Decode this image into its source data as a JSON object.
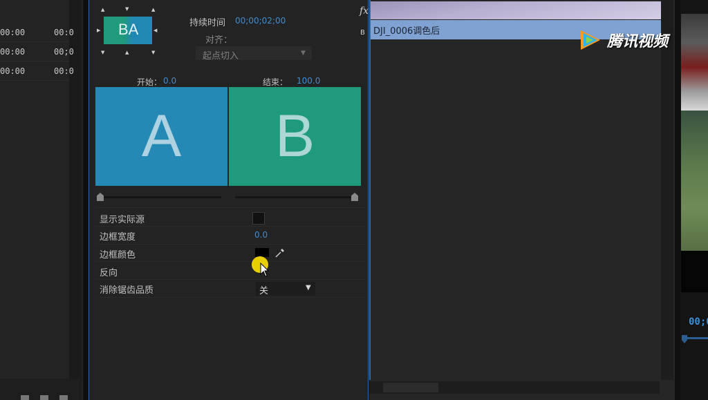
{
  "left_panel": {
    "rows": [
      {
        "c1": "00:00",
        "c2": "00:0"
      },
      {
        "c1": "00:00",
        "c2": "00;0"
      },
      {
        "c1": "00:00",
        "c2": "00:0"
      }
    ]
  },
  "effect_controls": {
    "thumb_letters": "BA",
    "duration_label": "持续时间",
    "duration_value": "00;00;02;00",
    "align_label": "对齐：",
    "align_value": "起点切入",
    "start_label": "开始：",
    "start_value": "0.0",
    "end_label": "结束：",
    "end_value": "100.0",
    "preview_a": "A",
    "preview_b": "B",
    "props": {
      "show_actual_sources": "显示实际源",
      "border_width": "边框宽度",
      "border_width_value": "0.0",
      "border_color": "边框颜色",
      "reverse": "反向",
      "antialias_quality": "消除锯齿品质",
      "antialias_value": "关"
    },
    "fx_badge": "fx",
    "track_letter": "B"
  },
  "timeline": {
    "clip_name": "DJI_0006调色后"
  },
  "watermark": {
    "text": "腾讯视频"
  },
  "monitor": {
    "timecode": "00;0"
  },
  "colors": {
    "accent_blue": "#3c8fd6",
    "preview_a": "#2589b5",
    "preview_b": "#1f9a7a",
    "clip_bar": "#7fa2d3",
    "cursor_highlight": "#e8d000"
  }
}
